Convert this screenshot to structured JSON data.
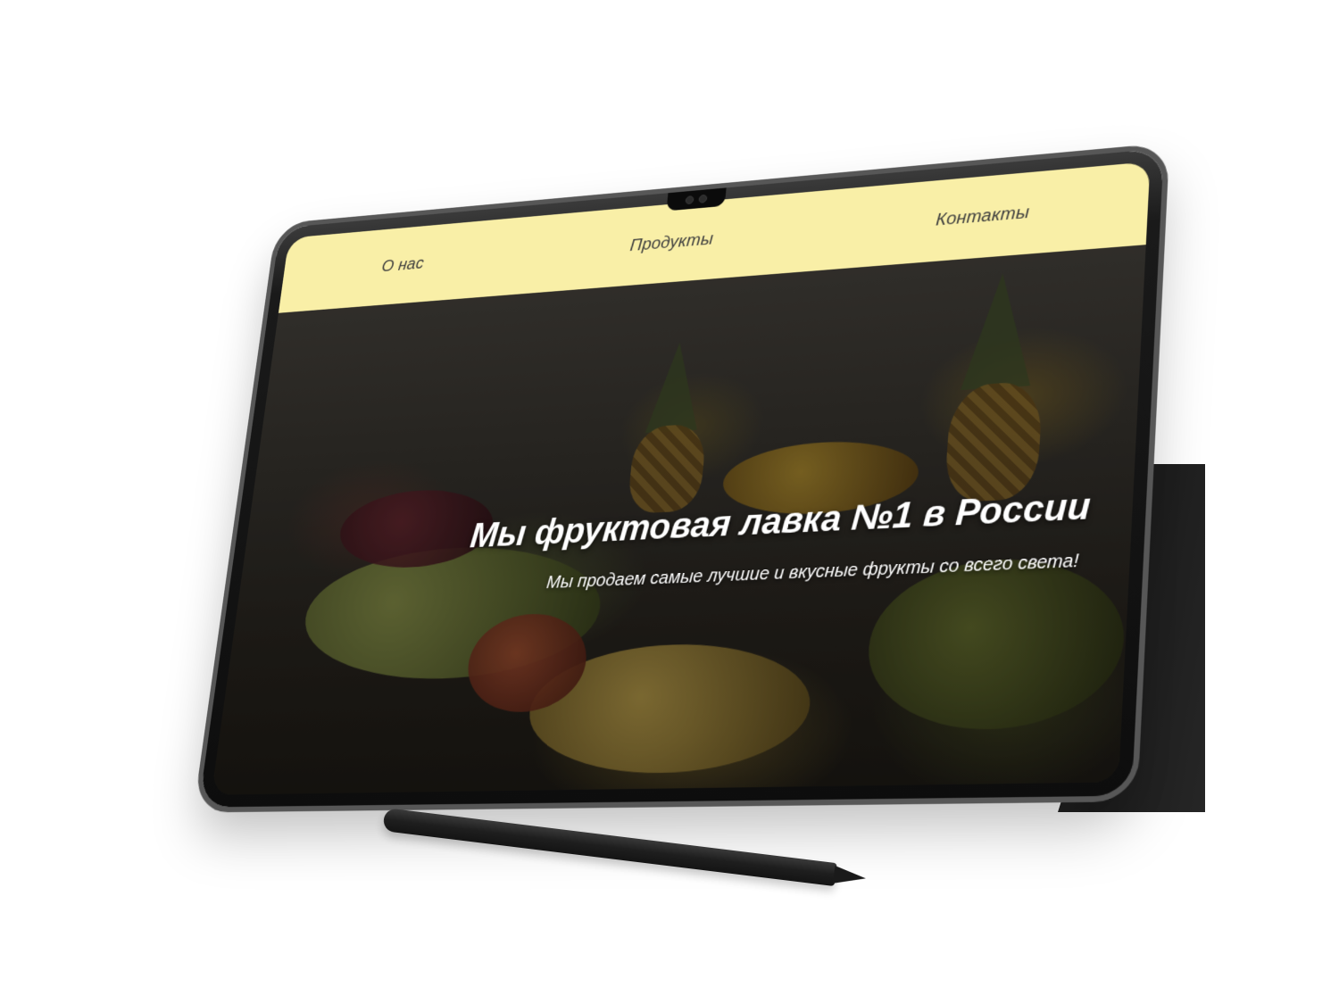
{
  "site": {
    "nav": {
      "about": "О нас",
      "products": "Продукты",
      "contacts": "Контакты"
    },
    "hero": {
      "title": "Мы фруктовая лавка №1 в России",
      "subtitle": "Мы продаем самые лучшие и вкусные фрукты со всего света!"
    }
  },
  "colors": {
    "nav_background": "#f9efa7",
    "nav_text": "#3d3d3d",
    "hero_text": "#ffffff",
    "device_frame": "#1a1a1a"
  },
  "icons": {
    "camera": "camera-icon"
  }
}
